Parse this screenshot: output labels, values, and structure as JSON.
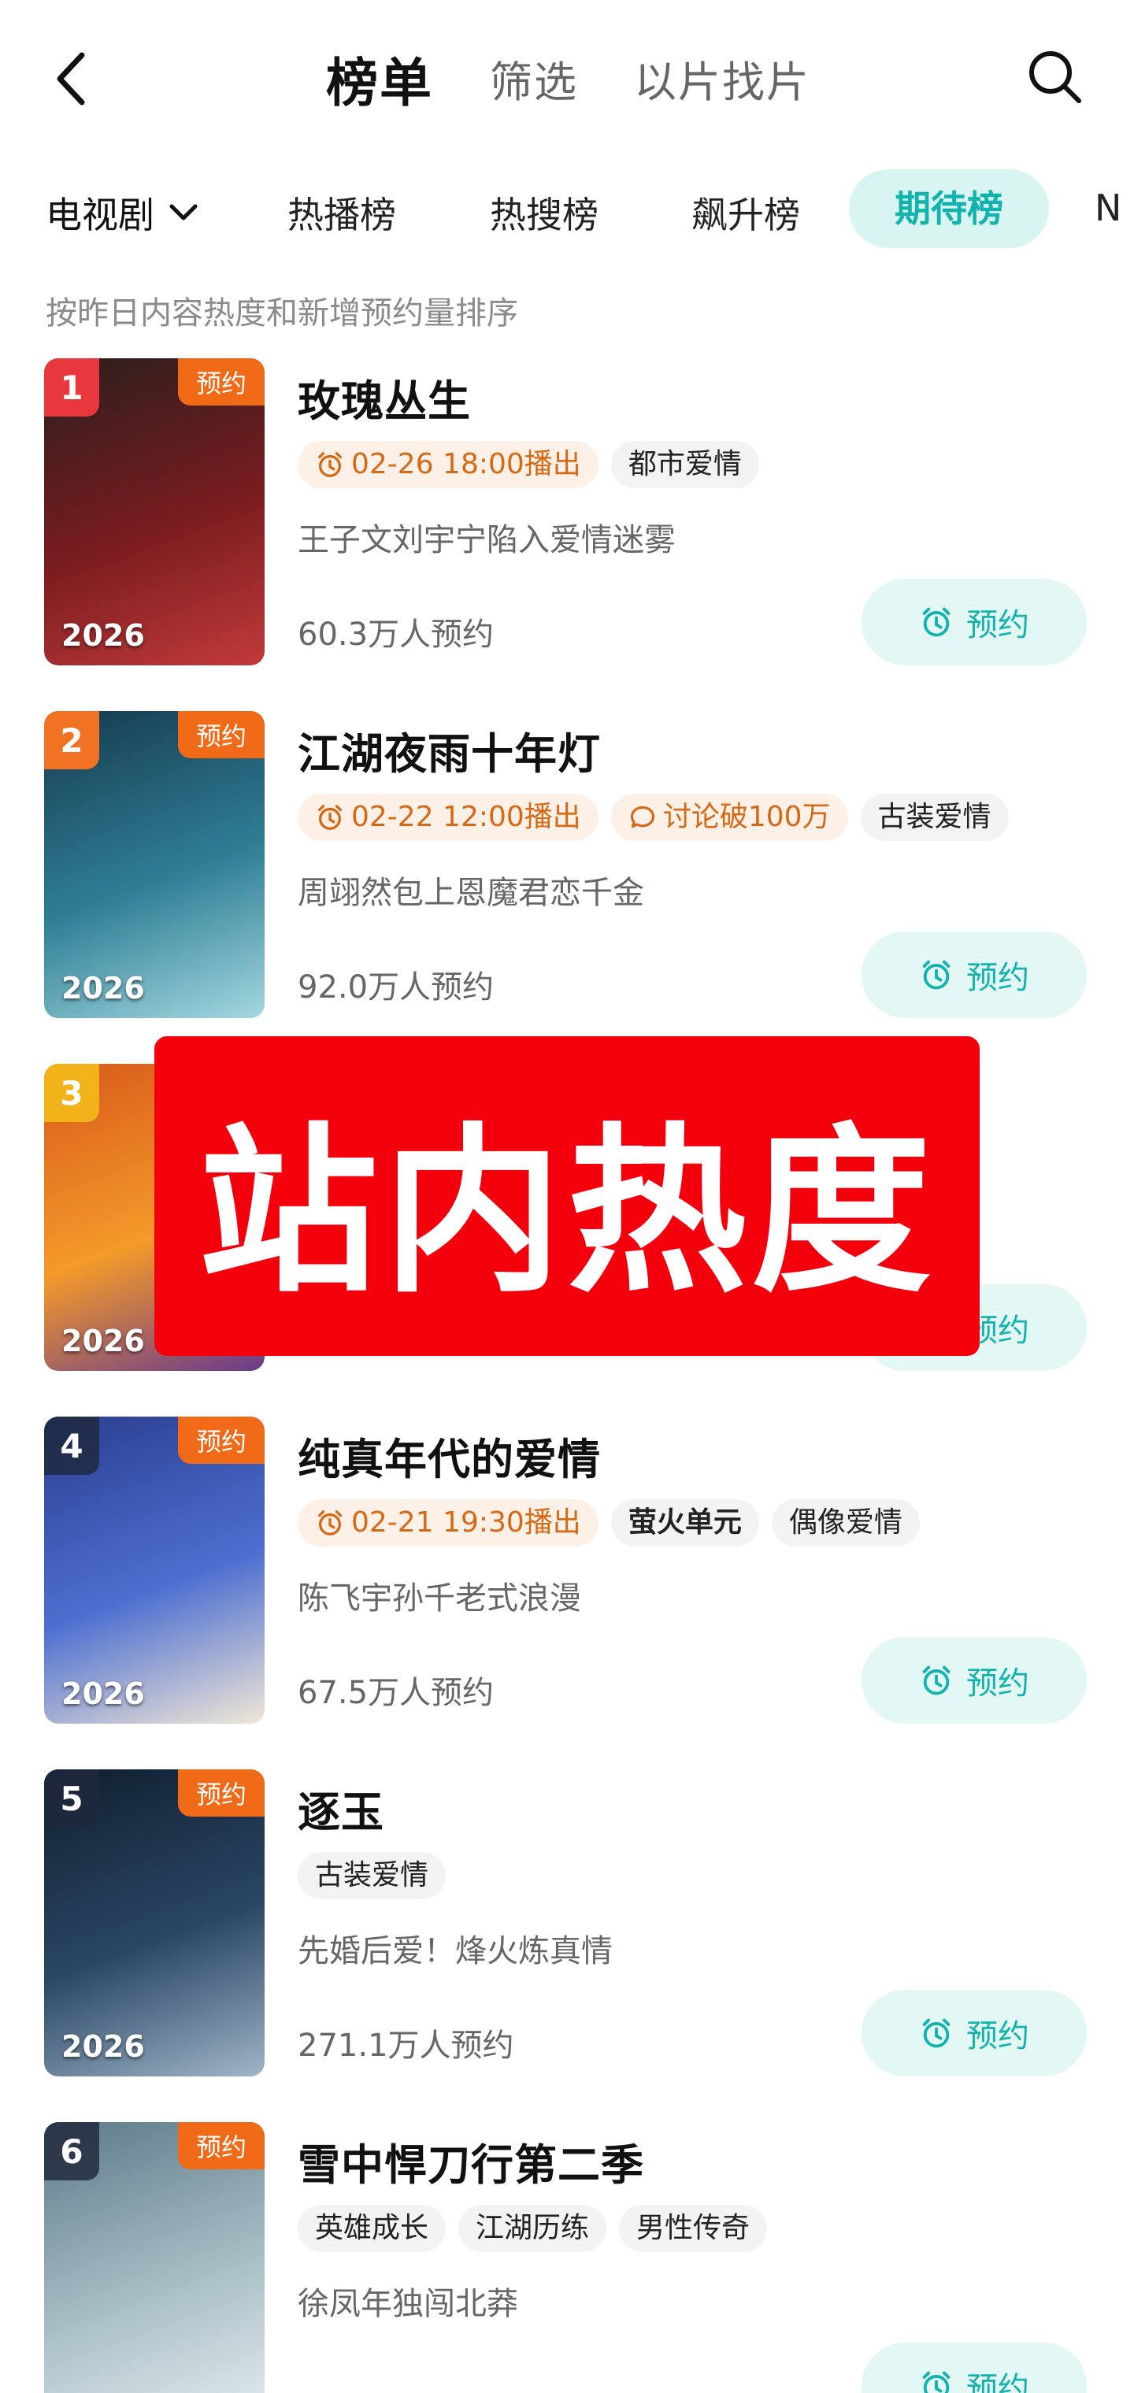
{
  "header": {
    "title": "榜单",
    "tabs": [
      "筛选",
      "以片找片"
    ]
  },
  "categories": {
    "dropdown_label": "电视剧",
    "tabs": [
      "热播榜",
      "热搜榜",
      "飙升榜",
      "期待榜",
      "N"
    ],
    "active_tab": "期待榜"
  },
  "subtitle": "按昨日内容热度和新增预约量排序",
  "badge_label": "预约",
  "reserve_label": "预约",
  "overlay_text": "站内热度",
  "items": [
    {
      "rank": "1",
      "year": "2026",
      "title": "玫瑰丛生",
      "air_time": "02-26 18:00播出",
      "tags": [
        "都市爱情"
      ],
      "desc": "王子文刘宇宁陷入爱情迷雾",
      "count": "60.3万人预约",
      "poster_colors": [
        "#2b1e1e",
        "#7a1c1f",
        "#c23a3a"
      ]
    },
    {
      "rank": "2",
      "year": "2026",
      "title": "江湖夜雨十年灯",
      "air_time": "02-22 12:00播出",
      "buzz": "讨论破100万",
      "tags": [
        "古装爱情"
      ],
      "desc": "周翊然包上恩魔君恋千金",
      "count": "92.0万人预约",
      "poster_colors": [
        "#163a4f",
        "#2f7f95",
        "#a4d8e0"
      ]
    },
    {
      "rank": "3",
      "year": "2026",
      "title": "",
      "tags": [],
      "desc": "",
      "count": "",
      "poster_colors": [
        "#d85a1a",
        "#f49a2a",
        "#6a3a8c"
      ]
    },
    {
      "rank": "4",
      "year": "2026",
      "title": "纯真年代的爱情",
      "air_time": "02-21 19:30播出",
      "brand_tag": "萤火单元",
      "tags": [
        "偶像爱情"
      ],
      "desc": "陈飞宇孙千老式浪漫",
      "count": "67.5万人预约",
      "poster_colors": [
        "#2a3e8f",
        "#4d6fd0",
        "#f1e7d8"
      ]
    },
    {
      "rank": "5",
      "year": "2026",
      "title": "逐玉",
      "tags": [
        "古装爱情"
      ],
      "desc": "先婚后爱！烽火炼真情",
      "count": "271.1万人预约",
      "poster_colors": [
        "#0f1e30",
        "#2b4763",
        "#9fb5c9"
      ]
    },
    {
      "rank": "6",
      "year": "",
      "title": "雪中悍刀行第二季",
      "tags": [
        "英雄成长",
        "江湖历练",
        "男性传奇"
      ],
      "desc": "徐凤年独闯北莽",
      "count": "",
      "poster_colors": [
        "#5c7a88",
        "#a9bfc7",
        "#e7eef0"
      ]
    }
  ],
  "colors": {
    "accent": "#13b3ad",
    "accent_bg": "#d8f5f2",
    "badge": "#f06a18",
    "air_time": "#d66915",
    "overlay": "#f4000c"
  }
}
